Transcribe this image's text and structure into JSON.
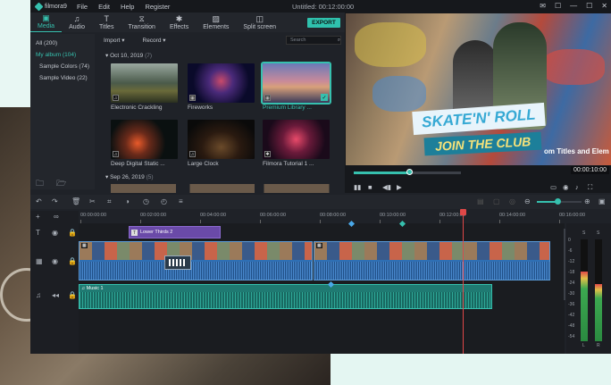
{
  "app": {
    "name": "filmora9",
    "menu": [
      "File",
      "Edit",
      "Help",
      "Register"
    ],
    "window_title": "Untitled: 00:12:00:00",
    "controls": [
      "✉",
      "☐",
      "—",
      "☐",
      "✕"
    ]
  },
  "tabs": [
    {
      "label": "Media",
      "icon": "▣"
    },
    {
      "label": "Audio",
      "icon": "♫"
    },
    {
      "label": "Titles",
      "icon": "T"
    },
    {
      "label": "Transition",
      "icon": "⧖"
    },
    {
      "label": "Effects",
      "icon": "✱"
    },
    {
      "label": "Elements",
      "icon": "▨"
    },
    {
      "label": "Split screen",
      "icon": "◫"
    }
  ],
  "export_label": "EXPORT",
  "library": {
    "items": [
      "All (200)",
      "My album (104)",
      "Sample Colors (74)",
      "Sample Video (22)"
    ],
    "import_label": "Import ▾",
    "record_label": "Record ▾",
    "search_placeholder": "Search"
  },
  "groups": [
    {
      "date": "Oct 10, 2019",
      "count": "(7)"
    },
    {
      "date": "Sep 26, 2019",
      "count": "(5)"
    }
  ],
  "media": [
    {
      "label": "Electronic Crackling",
      "badge": "♫",
      "bg": "linear-gradient(#9aa8a0,#4a5a4a 50%,#6a6a3a 70%,#2a3020)"
    },
    {
      "label": "Fireworks",
      "badge": "▦",
      "bg": "radial-gradient(circle at 50% 45%,#c84a6a 0%,#4a2a7a 30%,#0a0a2a 70%)"
    },
    {
      "label": "Premium Library ...",
      "badge": "▦",
      "bg": "linear-gradient(#6a7ab8,#c88a9a 45%,#d8a07a 60%,#3a3a5a)"
    },
    {
      "label": "Deep Digital Static ...",
      "badge": "♫",
      "bg": "radial-gradient(circle at 40% 60%,#e85a2a 0%,#6a2a1a 25%,#0a1010 60%)"
    },
    {
      "label": "Large Clock",
      "badge": "♫",
      "bg": "radial-gradient(ellipse at 50% 70%,#6a4a2a 0%,#2a1a10 40%,#0a0a0a 80%)"
    },
    {
      "label": "Filmora Tutorial 1 ...",
      "badge": "✱",
      "bg": "radial-gradient(circle at 50% 50%,#e84a6a 0%,#6a1a3a 35%,#1a0a1a 75%)"
    }
  ],
  "preview": {
    "headline": "SKATE'N' ROLL",
    "subline": "JOIN THE CLUB",
    "scroll_text": "om Titles and Elem",
    "time": "00:00:10:00",
    "progress": 0.52
  },
  "ruler": [
    "00:00:00:00",
    "00:02:00:00",
    "00:04:00:00",
    "00:06:00:00",
    "00:08:00:00",
    "00:10:00:00",
    "00:12:00:00",
    "00:14:00:00",
    "00:16:00:00"
  ],
  "timeline": {
    "title_clip": "Lower Thirds 2",
    "music_clip": "Music 1"
  },
  "meters": {
    "left_label": "L",
    "right_label": "R",
    "s": "S",
    "scale": [
      "0",
      "-6",
      "-12",
      "-18",
      "-24",
      "-30",
      "-36",
      "-42",
      "-48",
      "-54"
    ],
    "levels": [
      0.68,
      0.56
    ]
  },
  "colors": {
    "accent": "#36c0ae",
    "playhead": "#e04848",
    "title_clip": "#6a4aa8",
    "video_clip": "#2e6fb4",
    "audio_clip": "#1f7a72"
  }
}
